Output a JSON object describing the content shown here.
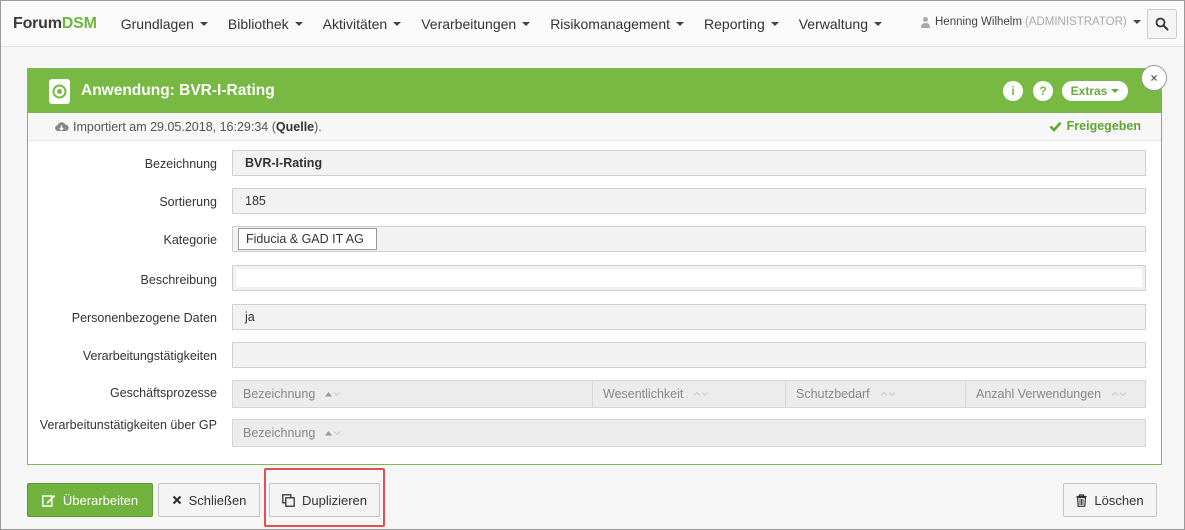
{
  "brand": {
    "prefix": "Forum",
    "accent": "DSM"
  },
  "menu": [
    {
      "label": "Grundlagen"
    },
    {
      "label": "Bibliothek"
    },
    {
      "label": "Aktivitäten"
    },
    {
      "label": "Verarbeitungen"
    },
    {
      "label": "Risikomanagement"
    },
    {
      "label": "Reporting"
    },
    {
      "label": "Verwaltung"
    }
  ],
  "user": {
    "name": "Henning Wilhelm",
    "role": "(ADMINISTRATOR)"
  },
  "panel": {
    "title": "Anwendung: BVR-I-Rating",
    "info_icon": "i",
    "help_icon": "?",
    "extras_label": "Extras",
    "close_glyph": "×",
    "info_prefix": "Importiert am 29.05.2018, 16:29:34 (",
    "info_source": "Quelle",
    "info_suffix": ").",
    "status": "Freigegeben"
  },
  "fields": {
    "bezeichnung": {
      "label": "Bezeichnung",
      "value": "BVR-I-Rating"
    },
    "sortierung": {
      "label": "Sortierung",
      "value": "185"
    },
    "kategorie": {
      "label": "Kategorie",
      "value": "Fiducia & GAD IT AG"
    },
    "beschreibung": {
      "label": "Beschreibung",
      "value": ""
    },
    "personenbezogen": {
      "label": "Personenbezogene Daten",
      "value": "ja"
    },
    "verarbeitungstaetigkeiten": {
      "label": "Verarbeitungstätigkeiten",
      "value": ""
    },
    "geschaeftsprozesse": {
      "label": "Geschäftsprozesse",
      "columns": [
        "Bezeichnung",
        "Wesentlichkeit",
        "Schutzbedarf",
        "Anzahl Verwendungen"
      ]
    },
    "verarbeitungen_gp": {
      "label": "Verarbeitunstätigkeiten über GP",
      "columns": [
        "Bezeichnung"
      ]
    }
  },
  "buttons": {
    "edit": "Überarbeiten",
    "close": "Schließen",
    "duplicate": "Duplizieren",
    "delete": "Löschen"
  },
  "colors": {
    "accent": "#78b943",
    "highlight": "#e05050"
  }
}
